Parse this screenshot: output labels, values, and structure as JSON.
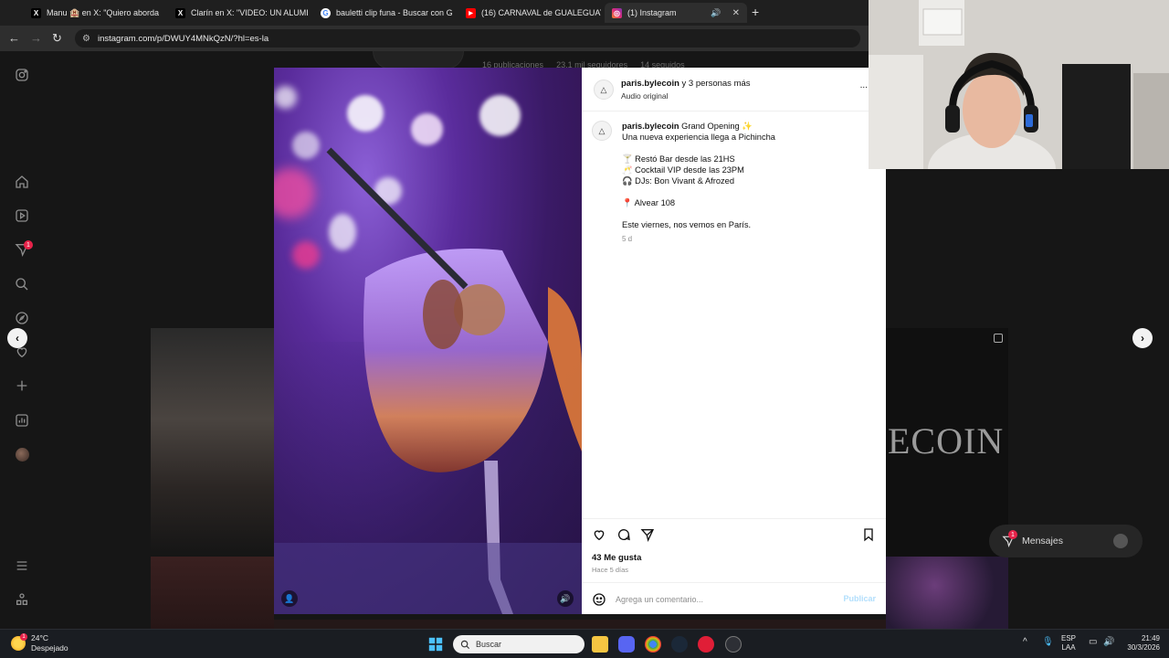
{
  "browser": {
    "tabs": [
      {
        "favicon": "X",
        "label": "Manu 🏨 en X: \"Quiero aborda",
        "close": "✕"
      },
      {
        "favicon": "X",
        "label": "Clarín en X: \"VIDEO: UN ALUMI",
        "close": "✕"
      },
      {
        "favicon": "G",
        "label": "bauletti clip funa - Buscar con G",
        "close": "✕"
      },
      {
        "favicon": "▶",
        "label": "(16) CARNAVAL de GUALEGUAY",
        "close": "✕"
      },
      {
        "favicon": "◎",
        "label": "(1) Instagram",
        "close": "✕"
      }
    ],
    "new_tab": "+",
    "url": "instagram.com/p/DWUY4MNkQzN/?hl=es-la"
  },
  "instagram": {
    "notification_count": "1",
    "profile_stats": [
      "16 publicaciones",
      "23,1 mil seguidores",
      "14 seguidos"
    ],
    "grid_logo_text": "ECOIN",
    "post": {
      "header_user": "paris.bylecoin",
      "header_rest": "y 3 personas más",
      "header_audio": "Audio original",
      "more": "...",
      "caption_author": "paris.bylecoin",
      "caption_lines": [
        "Grand Opening ✨",
        "Una nueva experiencia llega a Pichincha",
        "",
        "🍸 Restó Bar desde las 21HS",
        "🥂 Cocktail VIP desde las 23PM",
        "🎧 DJs: Bon Vivant & Afrozed",
        "",
        "📍 Alvear 108",
        "",
        "Este viernes, nos vemos en París."
      ],
      "caption_ago": "5 d",
      "likes": "43 Me gusta",
      "time": "Hace 5 días",
      "comment_placeholder": "Agrega un comentario...",
      "publish": "Publicar"
    },
    "messages": {
      "label": "Mensajes",
      "count": "1"
    }
  },
  "taskbar": {
    "weather_temp": "24°C",
    "weather_desc": "Despejado",
    "search_placeholder": "Buscar",
    "lang_1": "ESP",
    "lang_2": "LAA",
    "time": "21:49",
    "date": "30/3/2026",
    "weather_badge": "1"
  },
  "colors": {
    "accent_link": "#b2dffc",
    "badge": "#e7234a",
    "taskbar": "#1a1d22"
  }
}
